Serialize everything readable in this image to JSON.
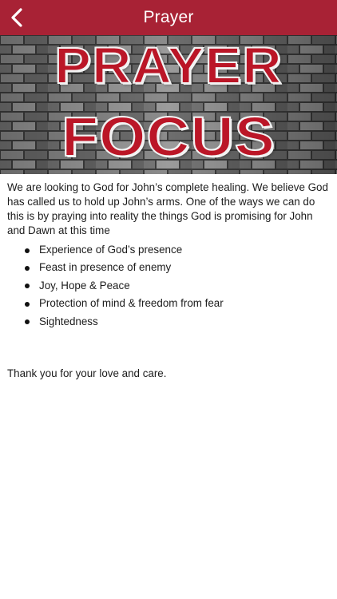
{
  "colors": {
    "nav_background": "#a82235",
    "nav_text": "#ffffff",
    "banner_letter_fill": "#bb1627",
    "body_text": "#1c1c1c"
  },
  "nav": {
    "title": "Prayer",
    "back_icon": "chevron-left-icon"
  },
  "banner": {
    "line1": "PRAYER",
    "line2": "FOCUS",
    "background": "brick-wall-texture"
  },
  "content": {
    "intro": "We are looking to God for John’s complete healing. We believe God has called us to hold up John’s arms. One of the ways we can do this is by praying into reality the things God is promising for John and Dawn at this time",
    "bullets": [
      "Experience of God’s presence",
      "Feast in presence of enemy",
      "Joy, Hope & Peace",
      "Protection of mind & freedom from fear",
      "Sightedness"
    ],
    "closing": "Thank you for your love and care."
  }
}
